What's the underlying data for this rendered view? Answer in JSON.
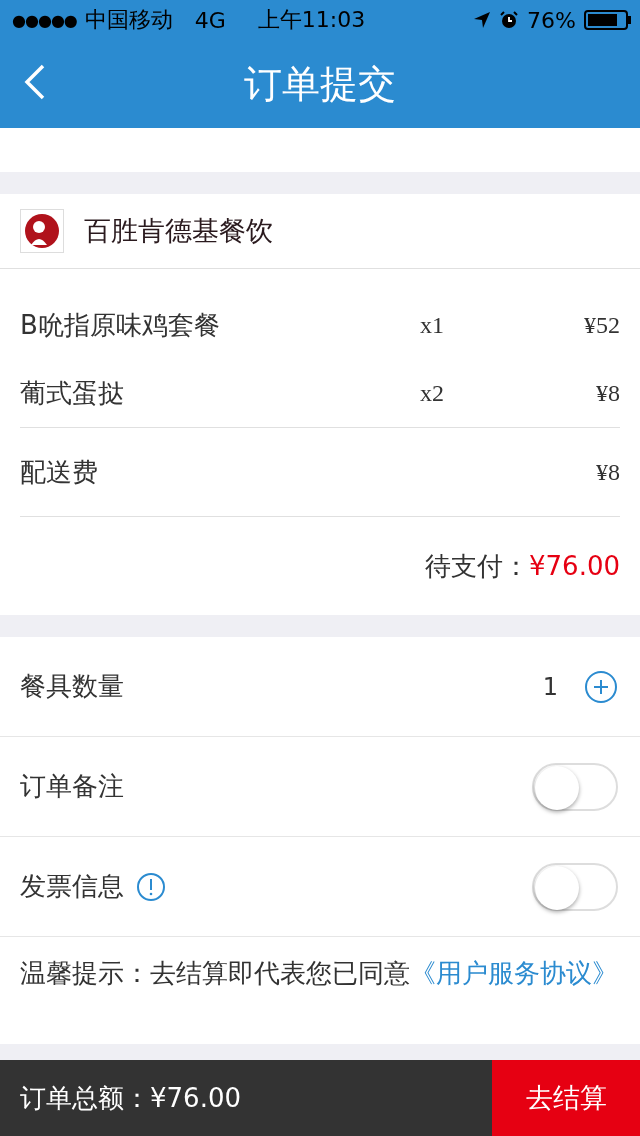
{
  "status_bar": {
    "signal": "●●●●●",
    "carrier": "中国移动",
    "network": "4G",
    "time": "上午11:03",
    "battery": "76%"
  },
  "header": {
    "title": "订单提交"
  },
  "store": {
    "name": "百胜肯德基餐饮"
  },
  "items": [
    {
      "name": "B吮指原味鸡套餐",
      "qty": "x1",
      "price": "¥52"
    },
    {
      "name": "葡式蛋挞",
      "qty": "x2",
      "price": "¥8"
    }
  ],
  "delivery": {
    "label": "配送费",
    "price": "¥8"
  },
  "due": {
    "label": "待支付：",
    "amount": "¥76.00"
  },
  "options": [
    {
      "kind": "counter",
      "label": "餐具数量",
      "value": "1"
    },
    {
      "kind": "switch",
      "label": "订单备注",
      "on": false
    },
    {
      "kind": "switch",
      "label": "发票信息",
      "on": false,
      "info": true
    }
  ],
  "notice": {
    "text": "温馨提示：去结算即代表您已同意",
    "link": "《用户服务协议》"
  },
  "footer": {
    "total_label": "订单总额：",
    "total": "¥76.00",
    "checkout": "去结算"
  }
}
